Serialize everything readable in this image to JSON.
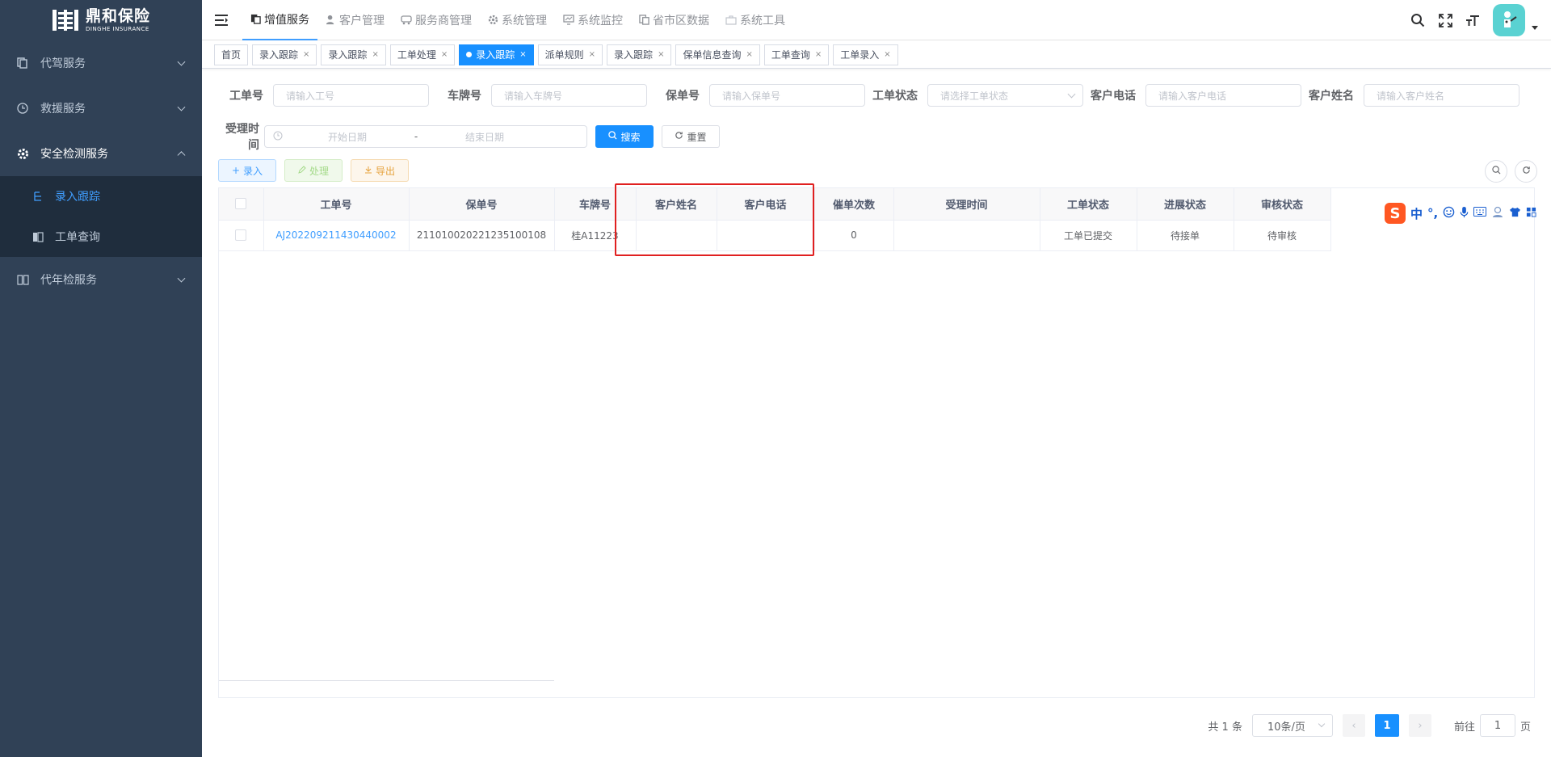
{
  "brand": {
    "name_cn": "鼎和保险",
    "name_en": "DINGHE INSURANCE",
    "color": "#304156",
    "accent": "#1890ff"
  },
  "sidebar": {
    "items": [
      {
        "label": "代驾服务",
        "icon": "copy-icon",
        "expanded": false
      },
      {
        "label": "救援服务",
        "icon": "clock-icon",
        "expanded": false
      },
      {
        "label": "安全检测服务",
        "icon": "gear-icon",
        "expanded": true,
        "children": [
          {
            "label": "录入跟踪",
            "icon": "tree-icon",
            "active": true
          },
          {
            "label": "工单查询",
            "icon": "book-icon",
            "active": false
          }
        ]
      },
      {
        "label": "代年检服务",
        "icon": "book-open-icon",
        "expanded": false
      }
    ]
  },
  "topnav": {
    "items": [
      {
        "label": "增值服务",
        "active": true
      },
      {
        "label": "客户管理",
        "active": false
      },
      {
        "label": "服务商管理",
        "active": false
      },
      {
        "label": "系统管理",
        "active": false
      },
      {
        "label": "系统监控",
        "active": false
      },
      {
        "label": "省市区数据",
        "active": false
      },
      {
        "label": "系统工具",
        "active": false
      }
    ]
  },
  "tags": [
    {
      "label": "首页",
      "closable": false,
      "active": false
    },
    {
      "label": "录入跟踪",
      "closable": true,
      "active": false
    },
    {
      "label": "录入跟踪",
      "closable": true,
      "active": false
    },
    {
      "label": "工单处理",
      "closable": true,
      "active": false
    },
    {
      "label": "录入跟踪",
      "closable": true,
      "active": true
    },
    {
      "label": "派单规则",
      "closable": true,
      "active": false
    },
    {
      "label": "录入跟踪",
      "closable": true,
      "active": false
    },
    {
      "label": "保单信息查询",
      "closable": true,
      "active": false
    },
    {
      "label": "工单查询",
      "closable": true,
      "active": false
    },
    {
      "label": "工单录入",
      "closable": true,
      "active": false
    }
  ],
  "search": {
    "work_no": {
      "label": "工单号",
      "placeholder": "请输入工号"
    },
    "plate_no": {
      "label": "车牌号",
      "placeholder": "请输入车牌号"
    },
    "policy_no": {
      "label": "保单号",
      "placeholder": "请输入保单号"
    },
    "status": {
      "label": "工单状态",
      "placeholder": "请选择工单状态"
    },
    "phone": {
      "label": "客户电话",
      "placeholder": "请输入客户电话"
    },
    "name": {
      "label": "客户姓名",
      "placeholder": "请输入客户姓名"
    },
    "accept_time": {
      "label": "受理时间",
      "start_placeholder": "开始日期",
      "separator": "-",
      "end_placeholder": "结束日期"
    },
    "search_button": "搜索",
    "reset_button": "重置"
  },
  "toolbar": {
    "add": "录入",
    "process": "处理",
    "export": "导出"
  },
  "table": {
    "columns": [
      "工单号",
      "保单号",
      "车牌号",
      "客户姓名",
      "客户电话",
      "催单次数",
      "受理时间",
      "工单状态",
      "进展状态",
      "审核状态"
    ],
    "rows": [
      {
        "work_no": "AJ202209211430440002",
        "policy_no": "211010020221235100108",
        "plate_no": "桂A11223",
        "customer_name": "",
        "customer_phone": "",
        "urge_count": "0",
        "accept_time": "",
        "work_status": "工单已提交",
        "progress_status": "待接单",
        "review_status": "待审核"
      }
    ]
  },
  "pagination": {
    "total_text": "共 1 条",
    "page_size": "10条/页",
    "current_page": "1",
    "goto_label": "前往",
    "goto_value": "1",
    "page_suffix": "页"
  },
  "ime": {
    "logo": "S",
    "lang": "中",
    "punct": "°,"
  }
}
